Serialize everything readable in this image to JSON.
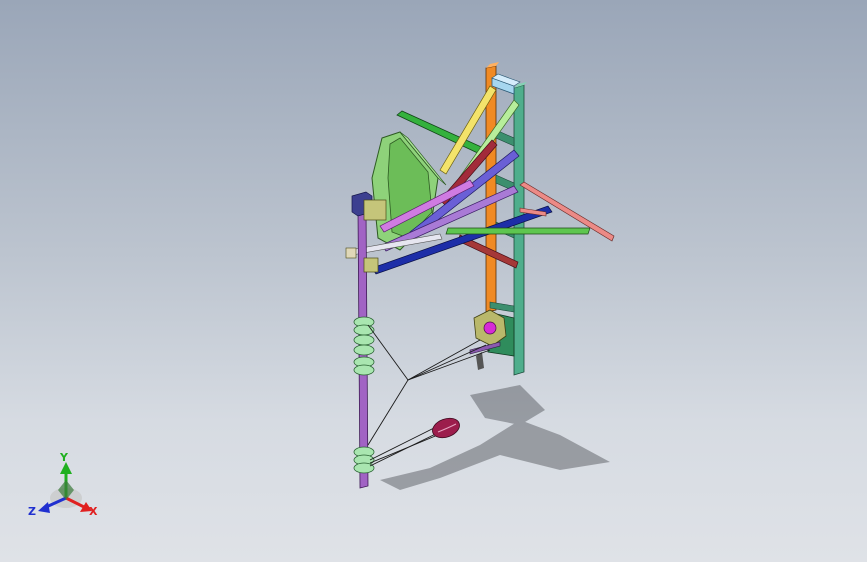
{
  "view": {
    "background_top": "#9aa6b8",
    "background_bottom": "#dfe2e7"
  },
  "triad": {
    "x_label": "X",
    "y_label": "Y",
    "z_label": "Z",
    "x_color": "#e02020",
    "y_color": "#1fb01f",
    "z_color": "#2030d0"
  },
  "model": {
    "parts": [
      "orange-column",
      "teal-column",
      "light-blue-cap",
      "green-hexagonal-panel",
      "green-beam",
      "yellow-brace",
      "light-green-brace",
      "blue-brace",
      "purple-brace",
      "pink-brace",
      "magenta-brace",
      "dark-red-brace",
      "navy-brace",
      "salmon-outrigger",
      "purple-mast",
      "coil-spring",
      "gear-motor",
      "cable-lines",
      "drogue-cone"
    ]
  }
}
